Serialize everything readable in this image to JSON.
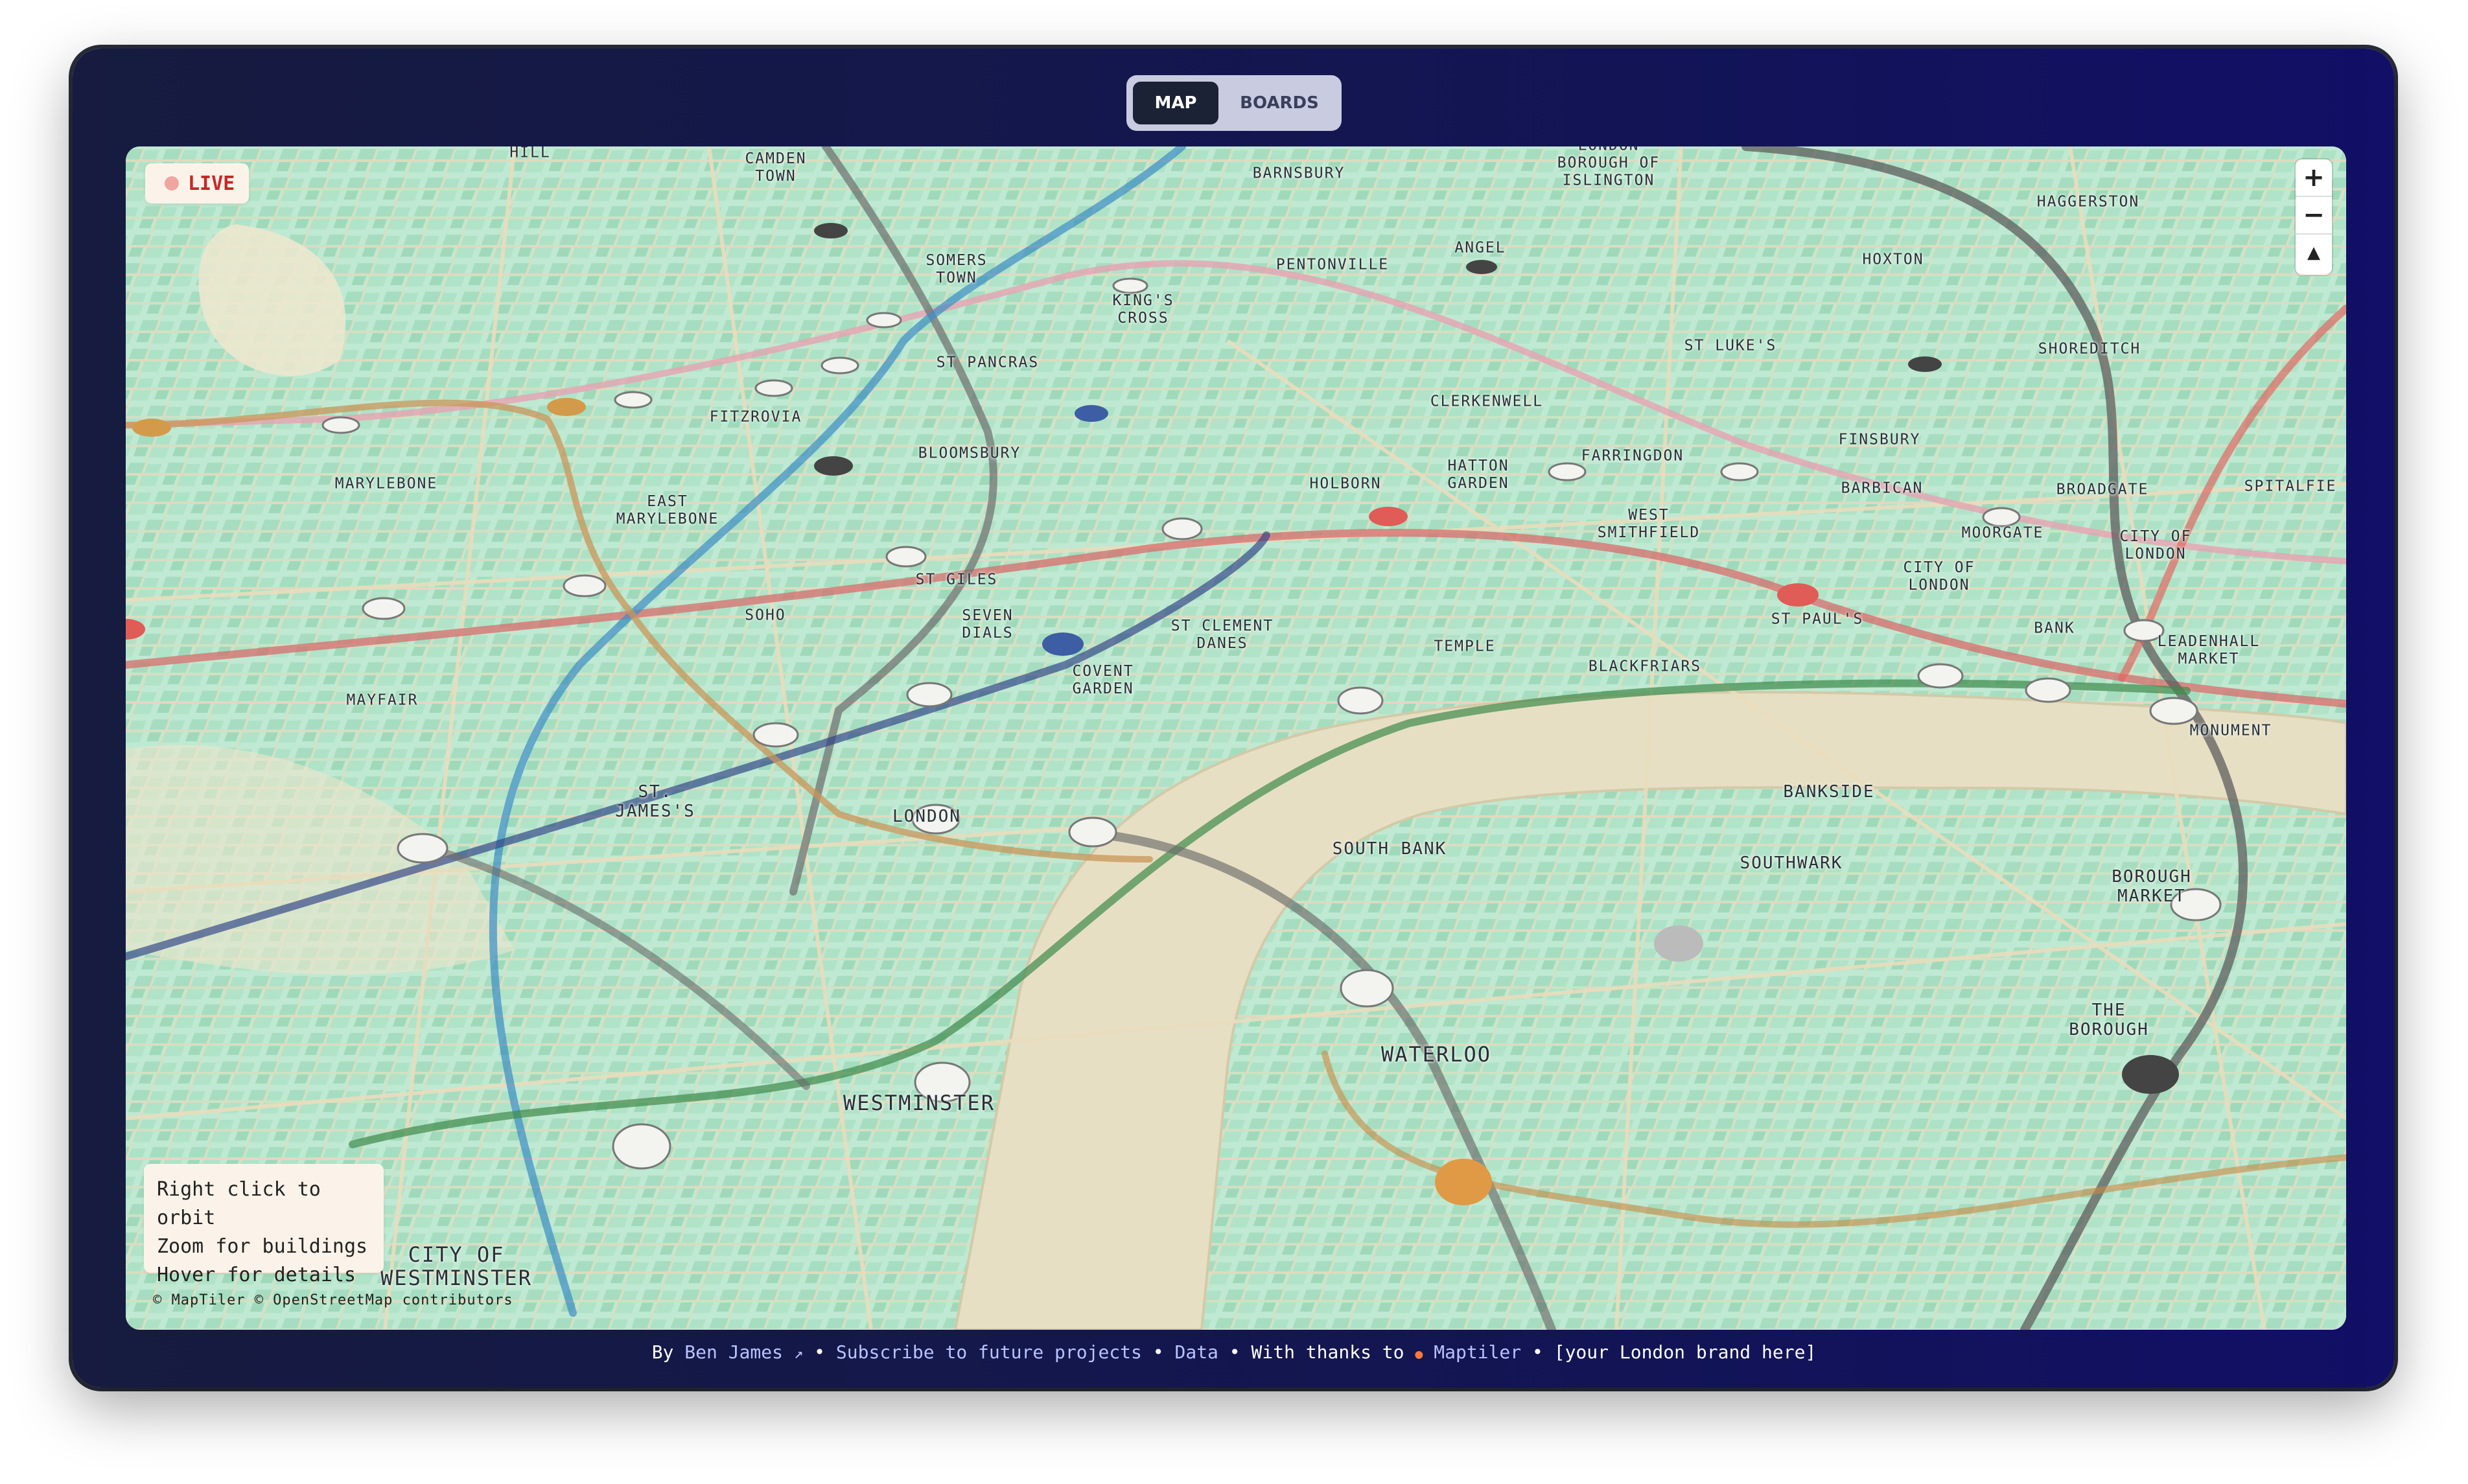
{
  "tabs": {
    "map": "MAP",
    "boards": "BOARDS"
  },
  "live": {
    "label": "LIVE"
  },
  "zoom": {
    "in": "+",
    "out": "−",
    "compass": "▲"
  },
  "help": {
    "line1": "Right click to orbit",
    "line2": "Zoom for buildings",
    "line3": "Hover for details"
  },
  "attribution": "© MapTiler © OpenStreetMap contributors",
  "footer": {
    "by": "By",
    "author": "Ben James",
    "sep": "•",
    "subscribe": "Subscribe to future projects",
    "data": "Data",
    "thanks": "With thanks to",
    "maptiler": "Maptiler",
    "brand": "[your London brand here]"
  },
  "areas": [
    {
      "name": "HILL"
    },
    {
      "name": "CAMDEN\nTOWN"
    },
    {
      "name": "BARNSBURY"
    },
    {
      "name": "LONDON\nBOROUGH OF\nISLINGTON"
    },
    {
      "name": "HAGGERSTON"
    },
    {
      "name": "SOMERS\nTOWN"
    },
    {
      "name": "PENTONVILLE"
    },
    {
      "name": "ANGEL"
    },
    {
      "name": "HOXTON"
    },
    {
      "name": "KING'S\nCROSS"
    },
    {
      "name": "ST PANCRAS"
    },
    {
      "name": "ST LUKE'S"
    },
    {
      "name": "SHOREDITCH"
    },
    {
      "name": "CLERKENWELL"
    },
    {
      "name": "FITZROVIA"
    },
    {
      "name": "FINSBURY"
    },
    {
      "name": "BLOOMSBURY"
    },
    {
      "name": "FARRINGDON"
    },
    {
      "name": "HATTON\nGARDEN"
    },
    {
      "name": "MARYLEBONE"
    },
    {
      "name": "HOLBORN"
    },
    {
      "name": "BARBICAN"
    },
    {
      "name": "BROADGATE"
    },
    {
      "name": "SPITALFIE"
    },
    {
      "name": "EAST\nMARYLEBONE"
    },
    {
      "name": "WEST\nSMITHFIELD"
    },
    {
      "name": "MOORGATE"
    },
    {
      "name": "CITY OF\nLONDON"
    },
    {
      "name": "ST GILES"
    },
    {
      "name": "CITY OF\nLONDON"
    },
    {
      "name": "SOHO"
    },
    {
      "name": "SEVEN\nDIALS"
    },
    {
      "name": "ST CLEMENT\nDANES"
    },
    {
      "name": "ST PAUL'S"
    },
    {
      "name": "BANK"
    },
    {
      "name": "LEADENHALL\nMARKET"
    },
    {
      "name": "TEMPLE"
    },
    {
      "name": "BLACKFRIARS"
    },
    {
      "name": "COVENT\nGARDEN"
    },
    {
      "name": "MAYFAIR"
    },
    {
      "name": "MONUMENT"
    },
    {
      "name": "ST.\nJAMES'S"
    },
    {
      "name": "BANKSIDE"
    },
    {
      "name": "LONDON"
    },
    {
      "name": "SOUTH BANK"
    },
    {
      "name": "SOUTHWARK"
    },
    {
      "name": "BOROUGH\nMARKET"
    },
    {
      "name": "THE\nBOROUGH"
    },
    {
      "name": "WATERLOO"
    },
    {
      "name": "WESTMINSTER"
    },
    {
      "name": "CITY OF\nWESTMINSTER"
    }
  ]
}
